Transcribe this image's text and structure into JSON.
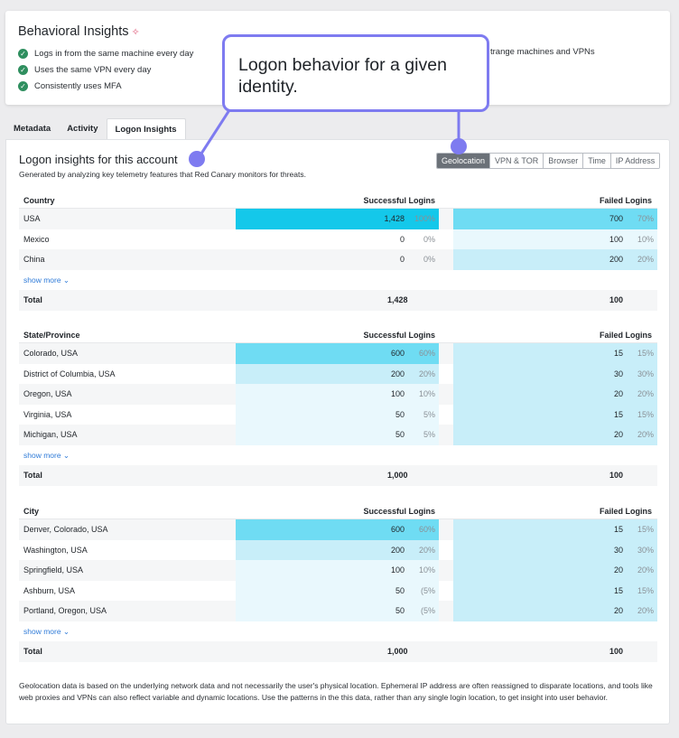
{
  "behavioral": {
    "title": "Behavioral Insights",
    "spark": "✧",
    "items": [
      "Logs in from the same machine every day",
      "Uses the same VPN every day",
      "Consistently uses MFA"
    ],
    "right_text": "trange machines and VPNs"
  },
  "tabs": [
    "Metadata",
    "Activity",
    "Logon Insights"
  ],
  "panel": {
    "title": "Logon insights for this account",
    "subtitle": "Generated by analyzing key telemetry features that Red Canary monitors for threats."
  },
  "segments": [
    "Geolocation",
    "VPN & TOR",
    "Browser",
    "Time",
    "IP Address"
  ],
  "tables": [
    {
      "header": "Country",
      "success_header": "Successful Logins",
      "failed_header": "Failed Logins",
      "rows": [
        {
          "label": "USA",
          "s": "1,428",
          "sp": "100%",
          "f": "700",
          "fp": "70%",
          "sc": "c-dark",
          "fc": "c-mid"
        },
        {
          "label": "Mexico",
          "s": "0",
          "sp": "0%",
          "f": "100",
          "fp": "10%",
          "sc": "",
          "fc": "c-pale"
        },
        {
          "label": "China",
          "s": "0",
          "sp": "0%",
          "f": "200",
          "fp": "20%",
          "sc": "",
          "fc": "c-light"
        }
      ],
      "more": "show more ⌄",
      "total_label": "Total",
      "total_s": "1,428",
      "total_f": "100"
    },
    {
      "header": "State/Province",
      "success_header": "Successful Logins",
      "failed_header": "Failed Logins",
      "rows": [
        {
          "label": "Colorado, USA",
          "s": "600",
          "sp": "60%",
          "f": "15",
          "fp": "15%",
          "sc": "c-mid",
          "fc": "c-light"
        },
        {
          "label": "District of Columbia, USA",
          "s": "200",
          "sp": "20%",
          "f": "30",
          "fp": "30%",
          "sc": "c-light",
          "fc": "c-light"
        },
        {
          "label": "Oregon, USA",
          "s": "100",
          "sp": "10%",
          "f": "20",
          "fp": "20%",
          "sc": "c-pale",
          "fc": "c-light"
        },
        {
          "label": "Virginia, USA",
          "s": "50",
          "sp": "5%",
          "f": "15",
          "fp": "15%",
          "sc": "c-pale",
          "fc": "c-light"
        },
        {
          "label": "Michigan, USA",
          "s": "50",
          "sp": "5%",
          "f": "20",
          "fp": "20%",
          "sc": "c-pale",
          "fc": "c-light"
        }
      ],
      "more": "show more ⌄",
      "total_label": "Total",
      "total_s": "1,000",
      "total_f": "100"
    },
    {
      "header": "City",
      "success_header": "Successful Logins",
      "failed_header": "Failed Logins",
      "rows": [
        {
          "label": "Denver, Colorado, USA",
          "s": "600",
          "sp": "60%",
          "f": "15",
          "fp": "15%",
          "sc": "c-mid",
          "fc": "c-light"
        },
        {
          "label": "Washington, USA",
          "s": "200",
          "sp": "20%",
          "f": "30",
          "fp": "30%",
          "sc": "c-light",
          "fc": "c-light"
        },
        {
          "label": "Springfield, USA",
          "s": "100",
          "sp": "10%",
          "f": "20",
          "fp": "20%",
          "sc": "c-pale",
          "fc": "c-light"
        },
        {
          "label": "Ashburn, USA",
          "s": "50",
          "sp": "(5%",
          "f": "15",
          "fp": "15%",
          "sc": "c-pale",
          "fc": "c-light"
        },
        {
          "label": "Portland, Oregon, USA",
          "s": "50",
          "sp": "(5%",
          "f": "20",
          "fp": "20%",
          "sc": "c-pale",
          "fc": "c-light"
        }
      ],
      "more": "show more ⌄",
      "total_label": "Total",
      "total_s": "1,000",
      "total_f": "100"
    }
  ],
  "note": "Geolocation data is based on the underlying network data and not necessarily the user's physical location. Ephemeral IP address are often reassigned to disparate locations, and tools like web proxies and VPNs can also reflect variable and dynamic locations. Use the patterns in the this data, rather than any single login location, to get insight into user behavior.",
  "callout": "Logon behavior for a given identity.",
  "colors": {
    "accent_callout": "#7e7bf0",
    "bar_dark": "#14c8ea",
    "bar_mid": "#6fdcf3",
    "bar_light": "#c8eef9",
    "check_green": "#2f8f5f"
  }
}
